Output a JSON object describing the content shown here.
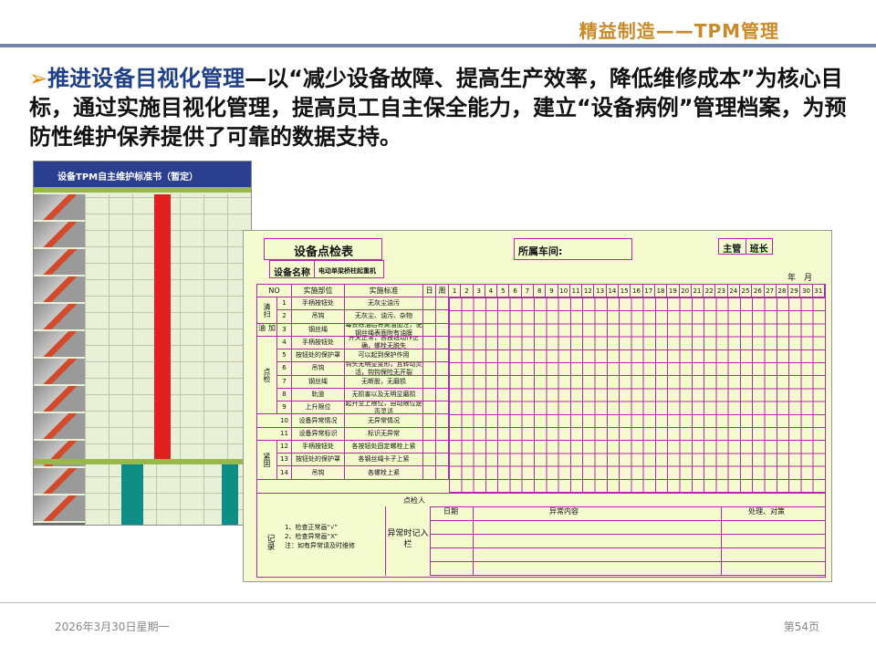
{
  "header": {
    "title": "精益制造——TPM管理"
  },
  "body": {
    "bullet": "➢",
    "highlight": "推进设备目视化管理",
    "text": "—以“减少设备故障、提高生产效率，降低维修成本”为核心目标，通过实施目视化管理，提高员工自主保全能力，建立“设备病例”管理档案，为预防性维护保养提供了可靠的数据支持。"
  },
  "sheet_left": {
    "title": "设备TPM自主维护标准书（暂定）"
  },
  "sheet_right": {
    "title": "设备点检表",
    "workshop_label": "所属车间:",
    "supervisor": "主管",
    "team_lead": "班长",
    "year_month": "年　月",
    "device_label": "设备名称",
    "device_value": "电动单梁桥柱起重机",
    "columns": {
      "no": "NO",
      "part": "实施部位",
      "standard": "实施标准",
      "day": "日",
      "cycle": "周",
      "month": "月"
    },
    "days": [
      "1",
      "2",
      "3",
      "4",
      "5",
      "6",
      "7",
      "8",
      "9",
      "10",
      "11",
      "12",
      "13",
      "14",
      "15",
      "16",
      "17",
      "18",
      "19",
      "20",
      "21",
      "22",
      "23",
      "24",
      "25",
      "26",
      "27",
      "28",
      "29",
      "30",
      "31"
    ],
    "categories": [
      "清扫",
      "加油",
      "点检",
      "紧固"
    ],
    "rows": [
      {
        "no": "1",
        "part": "手柄按钮处",
        "std": "无灰尘油污"
      },
      {
        "no": "2",
        "part": "吊钩",
        "std": "无灰尘、油污、杂物"
      },
      {
        "no": "3",
        "part": "钢丝绳",
        "std": "每去除油后将黄油加注，使钢丝绳表面附有油膜"
      },
      {
        "no": "4",
        "part": "手柄按钮处",
        "std": "开关正常，各按钮动作正确，螺栓无脱失"
      },
      {
        "no": "5",
        "part": "按钮处的保护罩",
        "std": "可以起到保护作用"
      },
      {
        "no": "6",
        "part": "吊钩",
        "std": "钩头无明显变形，且转动灵活，钩钩保险无开裂"
      },
      {
        "no": "7",
        "part": "钢丝绳",
        "std": "无断股，无磨损"
      },
      {
        "no": "8",
        "part": "轨道",
        "std": "无损害以及无明显磨损"
      },
      {
        "no": "9",
        "part": "上升限位",
        "std": "起升至上限位，自动限位是否灵活"
      },
      {
        "no": "10",
        "part": "设备异常情况",
        "std": "无异常情况"
      },
      {
        "no": "11",
        "part": "设备异常标识",
        "std": "标识无异常"
      },
      {
        "no": "12",
        "part": "手柄按钮处",
        "std": "各按钮处固定螺栓上紧"
      },
      {
        "no": "13",
        "part": "按钮处的保护罩",
        "std": "各钢丝绳卡子上紧"
      },
      {
        "no": "14",
        "part": "吊钩",
        "std": "各螺栓上紧"
      }
    ],
    "signer": "点检人",
    "record_label": "记录",
    "notes": [
      "1、检查正常画“√”",
      "2、检查异常画“X”",
      "注：如有异常请及时维修"
    ],
    "abnormal_label": "异常时记入栏",
    "record_cols": {
      "date": "日期",
      "content": "异常内容",
      "action": "处理、对策"
    }
  },
  "footer": {
    "date": "2026年3月30日星期一",
    "page": "第54页"
  }
}
